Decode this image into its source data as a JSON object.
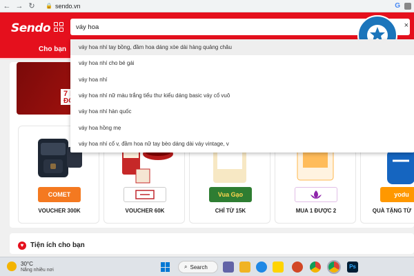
{
  "browser": {
    "url": "sendo.vn",
    "lock_icon": "lock-icon",
    "google_glyph": "G"
  },
  "header": {
    "logo": "Sendo",
    "search_value": "váy hoa",
    "close_icon": "×",
    "nav_label": "Cho bạn"
  },
  "suggestions": [
    "váy hoa nhí tay bồng, đầm hoa dáng xòe dài hàng quảng châu",
    "váy hoa nhí cho bé gái",
    "váy hoa nhí",
    "váy hoa nhí nữ màu trắng tiểu thư kiểu dáng basic váy cổ vuô",
    "váy hoa nhí hàn quốc",
    "váy hoa hồng mẹ",
    "váy hoa nhí cổ v, đầm hoa nữ tay bèo dáng dài váy vintage, v"
  ],
  "banner": {
    "line1": "7 N",
    "line2": "ĐỐ"
  },
  "vouchers": [
    {
      "label": "VOUCHER 300K",
      "brand": "COMET",
      "brand_bg": "#f47920",
      "brand_fg": "#ffffff"
    },
    {
      "label": "VOUCHER 60K",
      "brand": "",
      "brand_bg": "#ffffff",
      "brand_fg": "#c1272d"
    },
    {
      "label": "CHỈ TỪ 15K",
      "brand": "Vua Gạo",
      "brand_bg": "#2e7d32",
      "brand_fg": "#ffd54f"
    },
    {
      "label": "MUA 1 ĐƯỢC 2",
      "brand": "",
      "brand_bg": "#ffffff",
      "brand_fg": "#8e24aa"
    },
    {
      "label": "QUÀ TẶNG TỪ",
      "brand": "yodu",
      "brand_bg": "#ff9800",
      "brand_fg": "#ffffff"
    }
  ],
  "section": {
    "title": "Tiện ích cho bạn"
  },
  "taskbar": {
    "temperature": "30°C",
    "weather": "Nắng nhiều nơi",
    "search_label": "Search"
  },
  "colors": {
    "brand_red": "#e5101d",
    "uni_blue": "#1b75bb"
  }
}
